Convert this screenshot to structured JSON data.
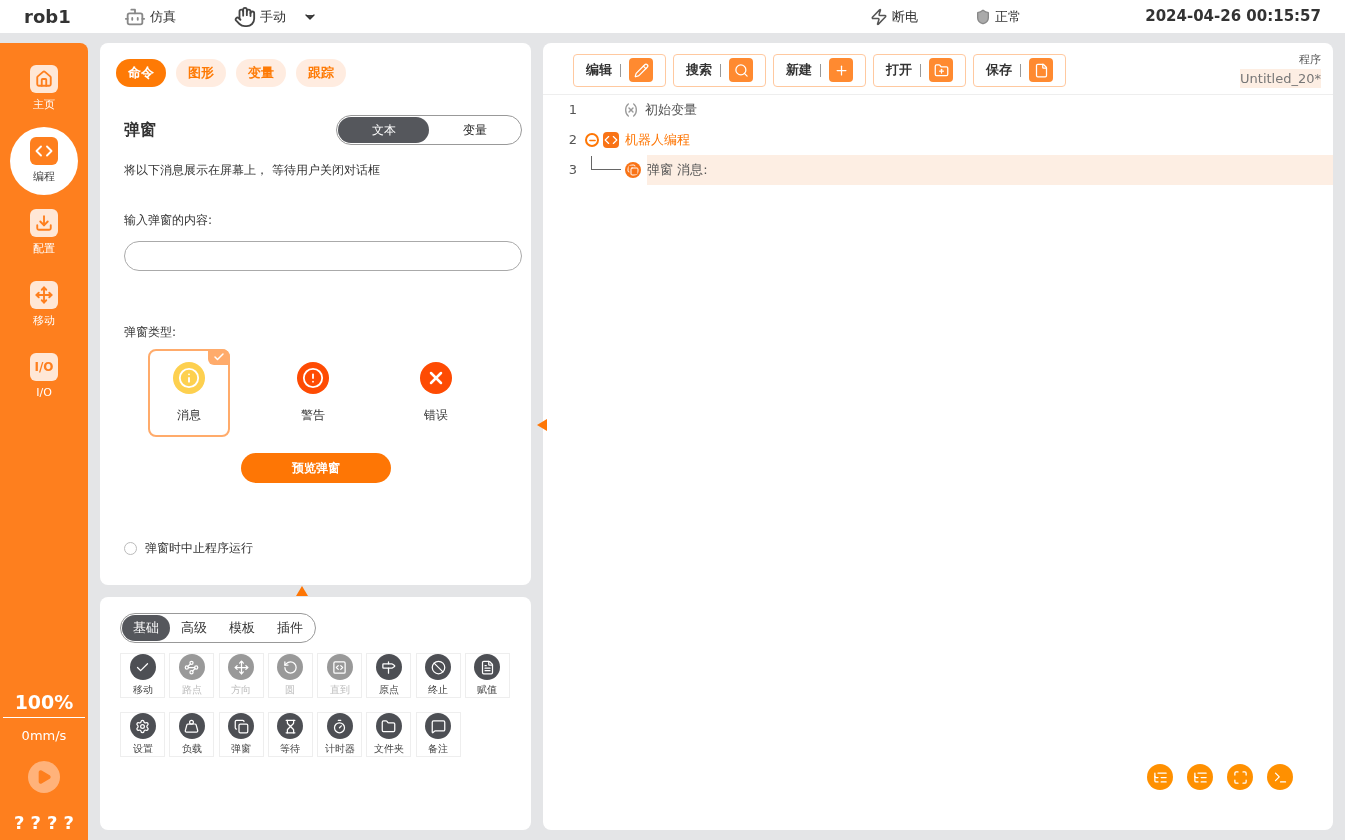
{
  "header": {
    "robot": "rob1",
    "sim_mode": "仿真",
    "control_mode": "手动",
    "power": "断电",
    "status": "正常",
    "datetime": "2024-04-26 00:15:57"
  },
  "sidebar": {
    "items": [
      {
        "label": "主页",
        "kind": "home",
        "selected": false
      },
      {
        "label": "编程",
        "kind": "program",
        "selected": true
      },
      {
        "label": "配置",
        "kind": "config",
        "selected": false
      },
      {
        "label": "移动",
        "kind": "move",
        "selected": false
      },
      {
        "label": "I/O",
        "kind": "io",
        "badge": "I/O",
        "selected": false
      }
    ],
    "speed": "100%",
    "velocity": "0mm/s",
    "footer": [
      "?",
      "?",
      "?",
      "?"
    ]
  },
  "command_tabs": [
    {
      "label": "命令",
      "selected": true
    },
    {
      "label": "图形",
      "selected": false
    },
    {
      "label": "变量",
      "selected": false
    },
    {
      "label": "跟踪",
      "selected": false
    }
  ],
  "popup": {
    "title": "弹窗",
    "source_toggle": [
      {
        "label": "文本",
        "selected": true
      },
      {
        "label": "变量",
        "selected": false
      }
    ],
    "description": "将以下消息展示在屏幕上， 等待用户关闭对话框",
    "content_label": "输入弹窗的内容:",
    "type_label": "弹窗类型:",
    "types": [
      {
        "label": "消息",
        "kind": "info",
        "selected": true
      },
      {
        "label": "警告",
        "kind": "warning",
        "selected": false
      },
      {
        "label": "错误",
        "kind": "error",
        "selected": false
      }
    ],
    "preview_button": "预览弹窗",
    "stop_option": {
      "label": "弹窗时中止程序运行",
      "checked": false
    }
  },
  "palette_tabs": [
    {
      "label": "基础",
      "selected": true
    },
    {
      "label": "高级",
      "selected": false
    },
    {
      "label": "模板",
      "selected": false
    },
    {
      "label": "插件",
      "selected": false
    }
  ],
  "palette_items": [
    {
      "label": "移动",
      "disabled": false
    },
    {
      "label": "路点",
      "disabled": true
    },
    {
      "label": "方向",
      "disabled": true
    },
    {
      "label": "圆",
      "disabled": true
    },
    {
      "label": "直到",
      "disabled": true
    },
    {
      "label": "原点",
      "disabled": false
    },
    {
      "label": "终止",
      "disabled": false
    },
    {
      "label": "赋值",
      "disabled": false
    },
    {
      "label": "设置",
      "disabled": false
    },
    {
      "label": "负载",
      "disabled": false
    },
    {
      "label": "弹窗",
      "disabled": false
    },
    {
      "label": "等待",
      "disabled": false
    },
    {
      "label": "计时器",
      "disabled": false
    },
    {
      "label": "文件夹",
      "disabled": false
    },
    {
      "label": "备注",
      "disabled": false
    }
  ],
  "toolbar": [
    {
      "label": "编辑"
    },
    {
      "label": "搜索"
    },
    {
      "label": "新建"
    },
    {
      "label": "打开"
    },
    {
      "label": "保存"
    }
  ],
  "program": {
    "label": "程序",
    "name": "Untitled_20*",
    "lines": [
      {
        "number": "1",
        "text": "初始变量",
        "kind": "init",
        "selected": false
      },
      {
        "number": "2",
        "text": "机器人编程",
        "kind": "root",
        "expanded": true,
        "selected": false
      },
      {
        "number": "3",
        "text": "弹窗 消息:",
        "kind": "popup",
        "selected": true
      }
    ]
  }
}
